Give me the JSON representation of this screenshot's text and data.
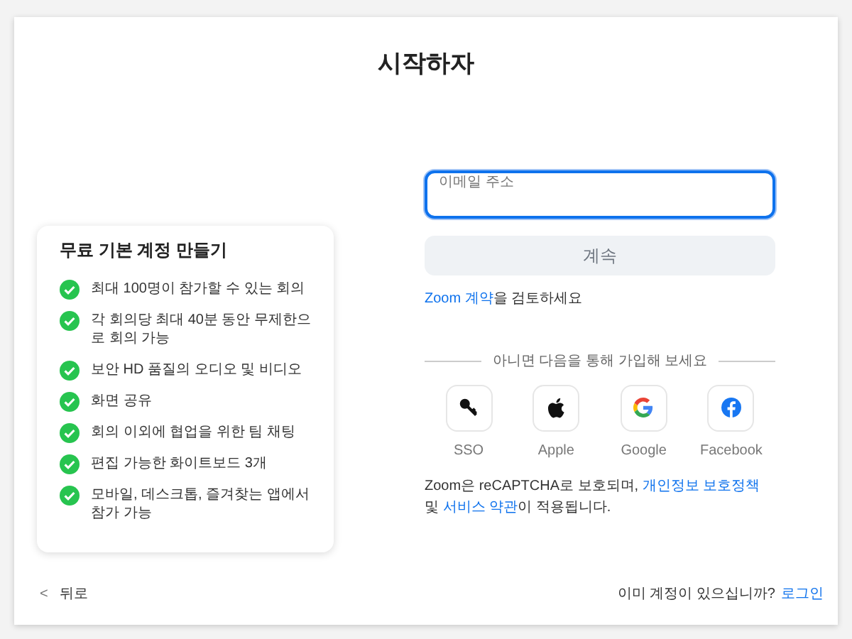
{
  "title": "시작하자",
  "plan_card": {
    "heading": "무료 기본 계정 만들기",
    "features": [
      {
        "text": "최대 100명이 참가할 수 있는 회의",
        "checked": true
      },
      {
        "text": "각 회의당 최대 40분 동안 무제한으로 회의 가능",
        "checked": true
      },
      {
        "text": "보안 HD 품질의 오디오 및 비디오",
        "checked": true
      },
      {
        "text": "화면 공유",
        "checked": true
      },
      {
        "text": "회의 이외에 협업을 위한 팀 채팅",
        "checked": true
      },
      {
        "text": "편집 가능한 화이트보드 3개",
        "checked": true
      },
      {
        "text": "모바일, 데스크톱, 즐겨찾는 앱에서 참가 가능",
        "checked": true
      }
    ]
  },
  "email_field": {
    "label": "이메일 주소",
    "focused": true
  },
  "continue_button": {
    "label": "계속",
    "disabled": true
  },
  "terms_note": [
    {
      "kind": "link",
      "text": "Zoom 계약"
    },
    {
      "kind": "text",
      "text": "을 검토하세요"
    }
  ],
  "divider_text": "아니면 다음을 통해 가입해 보세요",
  "providers": [
    {
      "kind": "sso",
      "label": "SSO"
    },
    {
      "kind": "apple",
      "label": "Apple"
    },
    {
      "kind": "google",
      "label": "Google"
    },
    {
      "kind": "facebook",
      "label": "Facebook"
    }
  ],
  "recaptcha_note": [
    {
      "kind": "text",
      "text": "Zoom은 reCAPTCHA로 보호되며, "
    },
    {
      "kind": "link",
      "text": "개인정보 보호정책"
    },
    {
      "kind": "text",
      "text": " 및 "
    },
    {
      "kind": "link",
      "text": "서비스 약관"
    },
    {
      "kind": "text",
      "text": "이 적용됩니다."
    }
  ],
  "back_link": {
    "icon": "<",
    "label": "뒤로"
  },
  "signin_prompt": {
    "text": "이미 계정이 있으십니까?",
    "link": "로그인"
  }
}
